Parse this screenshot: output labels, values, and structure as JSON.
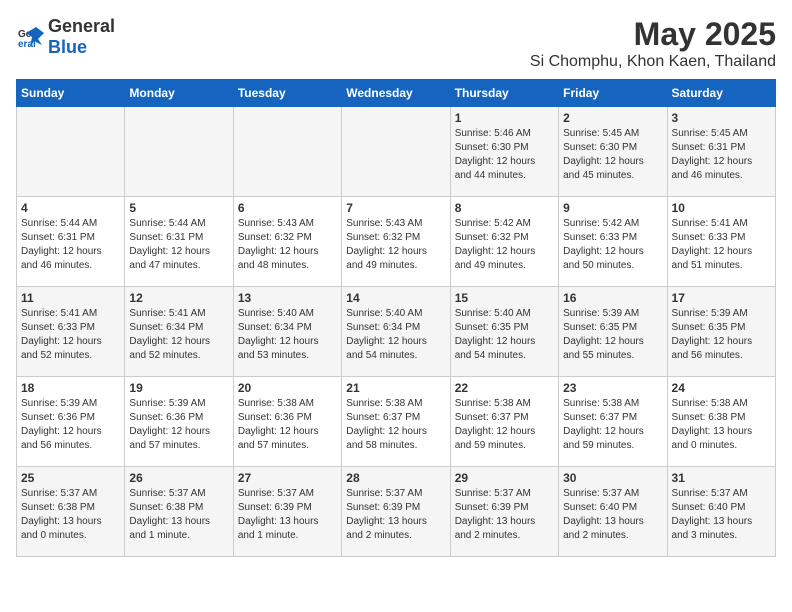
{
  "header": {
    "logo_general": "General",
    "logo_blue": "Blue",
    "title": "May 2025",
    "subtitle": "Si Chomphu, Khon Kaen, Thailand"
  },
  "days_of_week": [
    "Sunday",
    "Monday",
    "Tuesday",
    "Wednesday",
    "Thursday",
    "Friday",
    "Saturday"
  ],
  "weeks": [
    [
      {
        "day": "",
        "content": ""
      },
      {
        "day": "",
        "content": ""
      },
      {
        "day": "",
        "content": ""
      },
      {
        "day": "",
        "content": ""
      },
      {
        "day": "1",
        "content": "Sunrise: 5:46 AM\nSunset: 6:30 PM\nDaylight: 12 hours\nand 44 minutes."
      },
      {
        "day": "2",
        "content": "Sunrise: 5:45 AM\nSunset: 6:30 PM\nDaylight: 12 hours\nand 45 minutes."
      },
      {
        "day": "3",
        "content": "Sunrise: 5:45 AM\nSunset: 6:31 PM\nDaylight: 12 hours\nand 46 minutes."
      }
    ],
    [
      {
        "day": "4",
        "content": "Sunrise: 5:44 AM\nSunset: 6:31 PM\nDaylight: 12 hours\nand 46 minutes."
      },
      {
        "day": "5",
        "content": "Sunrise: 5:44 AM\nSunset: 6:31 PM\nDaylight: 12 hours\nand 47 minutes."
      },
      {
        "day": "6",
        "content": "Sunrise: 5:43 AM\nSunset: 6:32 PM\nDaylight: 12 hours\nand 48 minutes."
      },
      {
        "day": "7",
        "content": "Sunrise: 5:43 AM\nSunset: 6:32 PM\nDaylight: 12 hours\nand 49 minutes."
      },
      {
        "day": "8",
        "content": "Sunrise: 5:42 AM\nSunset: 6:32 PM\nDaylight: 12 hours\nand 49 minutes."
      },
      {
        "day": "9",
        "content": "Sunrise: 5:42 AM\nSunset: 6:33 PM\nDaylight: 12 hours\nand 50 minutes."
      },
      {
        "day": "10",
        "content": "Sunrise: 5:41 AM\nSunset: 6:33 PM\nDaylight: 12 hours\nand 51 minutes."
      }
    ],
    [
      {
        "day": "11",
        "content": "Sunrise: 5:41 AM\nSunset: 6:33 PM\nDaylight: 12 hours\nand 52 minutes."
      },
      {
        "day": "12",
        "content": "Sunrise: 5:41 AM\nSunset: 6:34 PM\nDaylight: 12 hours\nand 52 minutes."
      },
      {
        "day": "13",
        "content": "Sunrise: 5:40 AM\nSunset: 6:34 PM\nDaylight: 12 hours\nand 53 minutes."
      },
      {
        "day": "14",
        "content": "Sunrise: 5:40 AM\nSunset: 6:34 PM\nDaylight: 12 hours\nand 54 minutes."
      },
      {
        "day": "15",
        "content": "Sunrise: 5:40 AM\nSunset: 6:35 PM\nDaylight: 12 hours\nand 54 minutes."
      },
      {
        "day": "16",
        "content": "Sunrise: 5:39 AM\nSunset: 6:35 PM\nDaylight: 12 hours\nand 55 minutes."
      },
      {
        "day": "17",
        "content": "Sunrise: 5:39 AM\nSunset: 6:35 PM\nDaylight: 12 hours\nand 56 minutes."
      }
    ],
    [
      {
        "day": "18",
        "content": "Sunrise: 5:39 AM\nSunset: 6:36 PM\nDaylight: 12 hours\nand 56 minutes."
      },
      {
        "day": "19",
        "content": "Sunrise: 5:39 AM\nSunset: 6:36 PM\nDaylight: 12 hours\nand 57 minutes."
      },
      {
        "day": "20",
        "content": "Sunrise: 5:38 AM\nSunset: 6:36 PM\nDaylight: 12 hours\nand 57 minutes."
      },
      {
        "day": "21",
        "content": "Sunrise: 5:38 AM\nSunset: 6:37 PM\nDaylight: 12 hours\nand 58 minutes."
      },
      {
        "day": "22",
        "content": "Sunrise: 5:38 AM\nSunset: 6:37 PM\nDaylight: 12 hours\nand 59 minutes."
      },
      {
        "day": "23",
        "content": "Sunrise: 5:38 AM\nSunset: 6:37 PM\nDaylight: 12 hours\nand 59 minutes."
      },
      {
        "day": "24",
        "content": "Sunrise: 5:38 AM\nSunset: 6:38 PM\nDaylight: 13 hours\nand 0 minutes."
      }
    ],
    [
      {
        "day": "25",
        "content": "Sunrise: 5:37 AM\nSunset: 6:38 PM\nDaylight: 13 hours\nand 0 minutes."
      },
      {
        "day": "26",
        "content": "Sunrise: 5:37 AM\nSunset: 6:38 PM\nDaylight: 13 hours\nand 1 minute."
      },
      {
        "day": "27",
        "content": "Sunrise: 5:37 AM\nSunset: 6:39 PM\nDaylight: 13 hours\nand 1 minute."
      },
      {
        "day": "28",
        "content": "Sunrise: 5:37 AM\nSunset: 6:39 PM\nDaylight: 13 hours\nand 2 minutes."
      },
      {
        "day": "29",
        "content": "Sunrise: 5:37 AM\nSunset: 6:39 PM\nDaylight: 13 hours\nand 2 minutes."
      },
      {
        "day": "30",
        "content": "Sunrise: 5:37 AM\nSunset: 6:40 PM\nDaylight: 13 hours\nand 2 minutes."
      },
      {
        "day": "31",
        "content": "Sunrise: 5:37 AM\nSunset: 6:40 PM\nDaylight: 13 hours\nand 3 minutes."
      }
    ]
  ]
}
